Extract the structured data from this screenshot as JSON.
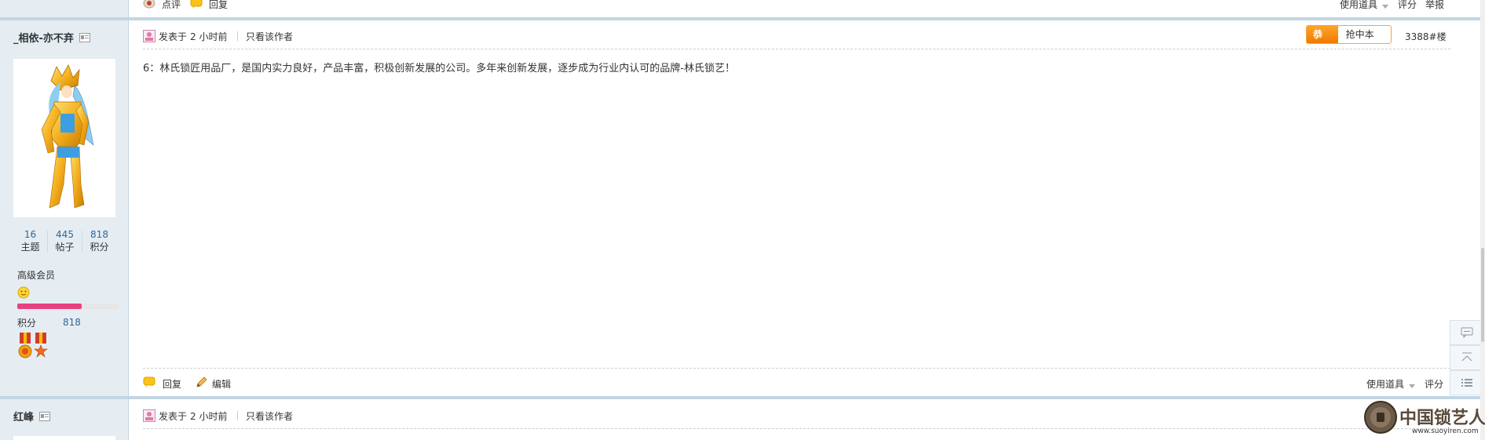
{
  "top_bar": {
    "comment_label": "点评",
    "reply_label": "回复",
    "tools_label": "使用道具",
    "rate_label": "评分",
    "report_label": "举报"
  },
  "post1": {
    "author": {
      "name": "_相依-亦不弃",
      "stats": [
        {
          "value": "16",
          "label": "主题"
        },
        {
          "value": "445",
          "label": "帖子"
        },
        {
          "value": "818",
          "label": "积分"
        }
      ],
      "rank": "高级会员",
      "progress_fraction": 0.63,
      "points_label": "积分",
      "points_value": "818"
    },
    "posted_label": "发表于",
    "posted_time": "2 小时前",
    "only_author_label": "只看该作者",
    "congrats_label": "恭喜",
    "grab_floor_label": "抢中本楼",
    "floor": "3388#楼",
    "content": "6：林氏锁匠用品厂，是国内实力良好，产品丰富，积极创新发展的公司。多年来创新发展，逐步成为行业内认可的品牌-林氏锁艺！",
    "reply_label": "回复",
    "edit_label": "编辑",
    "tools_label": "使用道具",
    "rate_label": "评分"
  },
  "post2": {
    "author": {
      "name": "红峰"
    },
    "posted_label": "发表于",
    "posted_time": "2 小时前",
    "only_author_label": "只看该作者"
  },
  "watermark": {
    "brand": "中国锁艺人",
    "url": "www.suoyiren.com"
  },
  "colors": {
    "sidebar_bg": "#e5edf2",
    "separator": "#c2d5e3",
    "link_blue": "#336699",
    "congrats_orange": "#f07a00",
    "progress_pink": "#e8417f"
  }
}
